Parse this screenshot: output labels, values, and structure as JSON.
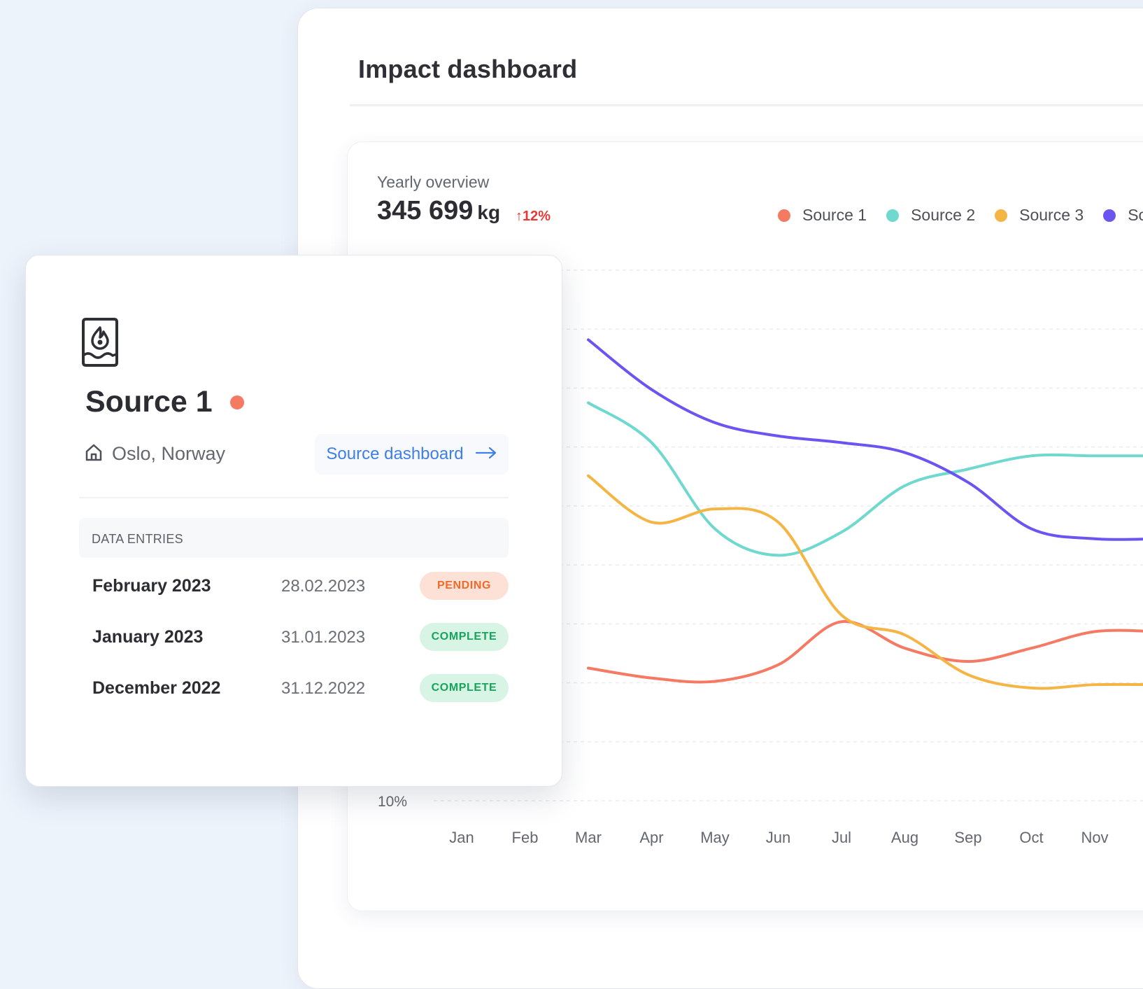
{
  "dashboard": {
    "title": "Impact dashboard",
    "overview": {
      "label": "Yearly overview",
      "total_value": "345 699",
      "total_unit": "kg",
      "change": "12%",
      "change_direction": "up"
    },
    "legend": [
      {
        "name": "Source 1",
        "color": "#f47a63"
      },
      {
        "name": "Source 2",
        "color": "#6fd8cf"
      },
      {
        "name": "Source 3",
        "color": "#f5b545"
      },
      {
        "name": "Sou",
        "color": "#6b55f0"
      }
    ]
  },
  "chart_data": {
    "type": "line",
    "categories": [
      "Jan",
      "Feb",
      "Mar",
      "Apr",
      "May",
      "Jun",
      "Jul",
      "Aug",
      "Sep",
      "Oct",
      "Nov"
    ],
    "y_tick_labels": [
      "10%"
    ],
    "ylim": [
      10,
      90
    ],
    "grid": true,
    "legend": "top-right",
    "series": [
      {
        "name": "Source 1",
        "color": "#f47a63",
        "values": [
          null,
          null,
          30,
          28.5,
          28,
          30.5,
          37,
          33,
          31,
          33,
          35.5
        ]
      },
      {
        "name": "Source 2",
        "color": "#6fd8cf",
        "values": [
          null,
          null,
          70,
          64,
          51,
          47,
          50.5,
          57.5,
          60,
          62,
          62
        ]
      },
      {
        "name": "Source 3",
        "color": "#f5b545",
        "values": [
          null,
          null,
          59,
          52,
          54,
          52,
          38,
          35,
          29,
          27,
          27.5
        ]
      },
      {
        "name": "Sou",
        "color": "#6b55f0",
        "values": [
          null,
          null,
          79.5,
          72,
          67,
          65,
          64,
          62.5,
          58,
          51,
          49.5
        ]
      }
    ]
  },
  "source_card": {
    "name": "Source 1",
    "location": "Oslo, Norway",
    "dashboard_link": "Source dashboard",
    "entries_title": "DATA ENTRIES",
    "entries": [
      {
        "month": "February 2023",
        "date": "28.02.2023",
        "status": "PENDING",
        "status_key": "pending"
      },
      {
        "month": "January 2023",
        "date": "31.01.2023",
        "status": "COMPLETE",
        "status_key": "complete"
      },
      {
        "month": "December 2022",
        "date": "31.12.2022",
        "status": "COMPLETE",
        "status_key": "complete"
      }
    ]
  }
}
